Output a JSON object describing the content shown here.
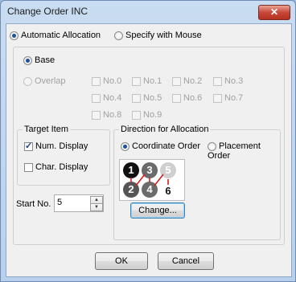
{
  "window": {
    "title": "Change Order INC"
  },
  "mode": {
    "automatic_label": "Automatic Allocation",
    "mouse_label": "Specify with Mouse"
  },
  "allocation": {
    "base_label": "Base",
    "overlap_label": "Overlap",
    "slots": [
      "No.0",
      "No.1",
      "No.2",
      "No.3",
      "No.4",
      "No.5",
      "No.6",
      "No.7",
      "No.8",
      "No.9"
    ]
  },
  "target": {
    "legend": "Target Item",
    "num_label": "Num. Display",
    "char_label": "Char. Display"
  },
  "direction": {
    "legend": "Direction for Allocation",
    "coordinate_label": "Coordinate Order",
    "placement_label": "Placement Order",
    "change_label": "Change...",
    "preview_numbers": [
      "1",
      "3",
      "5",
      "2",
      "4",
      "6"
    ]
  },
  "start": {
    "label": "Start No.",
    "value": "5"
  },
  "footer": {
    "ok_label": "OK",
    "cancel_label": "Cancel"
  },
  "colors": {
    "arrow": "#d42020",
    "dark_digit": "#111111",
    "gray_digit": "#6b6b6b",
    "light_digit": "#cfcfcf"
  }
}
